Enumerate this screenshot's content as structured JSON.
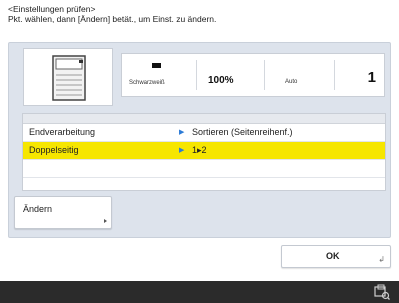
{
  "header": {
    "title": "<Einstellungen prüfen>",
    "instruction": "Pkt. wählen, dann [Ändern] betät., um Einst. zu ändern."
  },
  "summary": {
    "color_mode": "Schwarzweiß",
    "zoom": "100%",
    "paper": "Auto",
    "copies": "1"
  },
  "settings": [
    {
      "label": "Endverarbeitung",
      "value": "Sortieren (Seitenreihenf.)",
      "selected": false
    },
    {
      "label": "Doppelseitig",
      "value": "1▸2",
      "selected": true
    }
  ],
  "buttons": {
    "change": "Ändern",
    "ok": "OK"
  },
  "icons": {
    "thumbnail": "printer-icon",
    "status": "status-monitor-icon"
  },
  "colors": {
    "selected_row": "#f6e600",
    "panel": "#dde3ec",
    "footer": "#2b2b2b",
    "arrow": "#2c7bd6"
  }
}
